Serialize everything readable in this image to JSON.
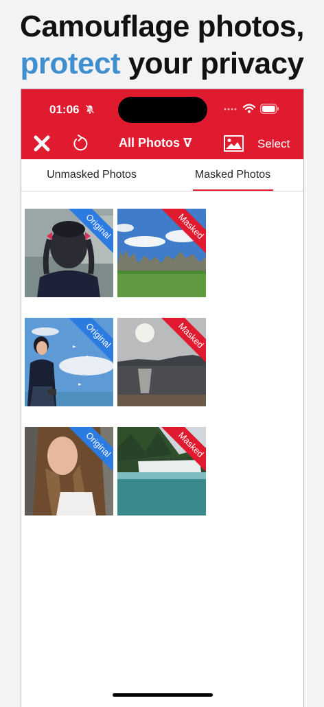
{
  "headline": {
    "line1": "Camouflage photos,",
    "line2_accent": "protect",
    "line2_rest": " your privacy"
  },
  "status_bar": {
    "time": "01:06"
  },
  "toolbar": {
    "album_label": "All Photos ∇",
    "select_label": "Select"
  },
  "tabs": {
    "unmasked": "Unmasked Photos",
    "masked": "Masked Photos",
    "active": "masked"
  },
  "photos": [
    {
      "badge": "Original",
      "subject": "anime girl with pigtails"
    },
    {
      "badge": "Masked",
      "subject": "stone forest landscape"
    },
    {
      "badge": "Original",
      "subject": "girl in school uniform at seaside"
    },
    {
      "badge": "Masked",
      "subject": "lake at sunset"
    },
    {
      "badge": "Original",
      "subject": "woman with braided hair"
    },
    {
      "badge": "Masked",
      "subject": "waterfall"
    }
  ],
  "colors": {
    "brand_red": "#e01b2f",
    "accent_blue": "#3f8fce",
    "original_badge": "#2c7be0"
  }
}
